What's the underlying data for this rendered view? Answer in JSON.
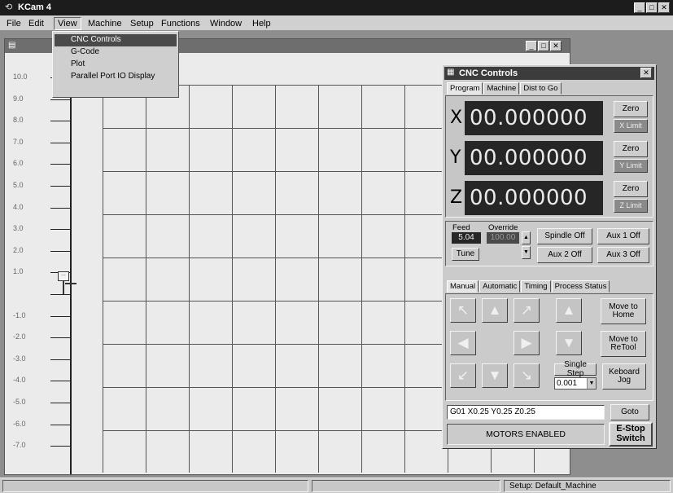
{
  "app": {
    "title": "KCam 4"
  },
  "menu": {
    "items": [
      "File",
      "Edit",
      "View",
      "Machine",
      "Setup",
      "Functions",
      "Window",
      "Help"
    ]
  },
  "view_menu": {
    "items": [
      "CNC Controls",
      "G-Code",
      "Plot",
      "Parallel Port IO Display"
    ]
  },
  "plot": {
    "y_ticks": [
      "10.0",
      "9.0",
      "8.0",
      "7.0",
      "6.0",
      "5.0",
      "4.0",
      "3.0",
      "2.0",
      "1.0",
      "",
      "-1.0",
      "-2.0",
      "-3.0",
      "-4.0",
      "-5.0",
      "-6.0",
      "-7.0"
    ]
  },
  "cnc": {
    "title": "CNC Controls",
    "close": "✕",
    "tabs": [
      "Program",
      "Machine",
      "Dist to Go"
    ],
    "axes": [
      {
        "letter": "X",
        "value": "00.000000",
        "zero": "Zero",
        "limit": "X Limit"
      },
      {
        "letter": "Y",
        "value": "00.000000",
        "zero": "Zero",
        "limit": "Y Limit"
      },
      {
        "letter": "Z",
        "value": "00.000000",
        "zero": "Zero",
        "limit": "Z Limit"
      }
    ],
    "feed_label": "Feed",
    "feed_value": "5.04",
    "override_label": "Override",
    "override_value": "100.00",
    "tune": "Tune",
    "spindle": "Spindle Off",
    "aux1": "Aux 1 Off",
    "aux2": "Aux 2 Off",
    "aux3": "Aux 3 Off",
    "mode_tabs": [
      "Manual",
      "Automatic",
      "Timing",
      "Process Status"
    ],
    "move_home": "Move to Home",
    "move_retool": "Move to ReTool",
    "single_step": "Single Step",
    "step_value": "0.001",
    "keyboard_jog": "Keboard Jog",
    "command": "G01 X0.25 Y0.25 Z0.25",
    "goto": "Goto",
    "motors": "MOTORS ENABLED",
    "estop": "E-Stop Switch"
  },
  "status": {
    "setup": "Setup: Default_Machine"
  },
  "colors": {
    "title_bar": "#1c1c1c",
    "dro_bg": "#262626",
    "dro_text": "#eaeaea",
    "workspace": "#8e8e8e"
  }
}
